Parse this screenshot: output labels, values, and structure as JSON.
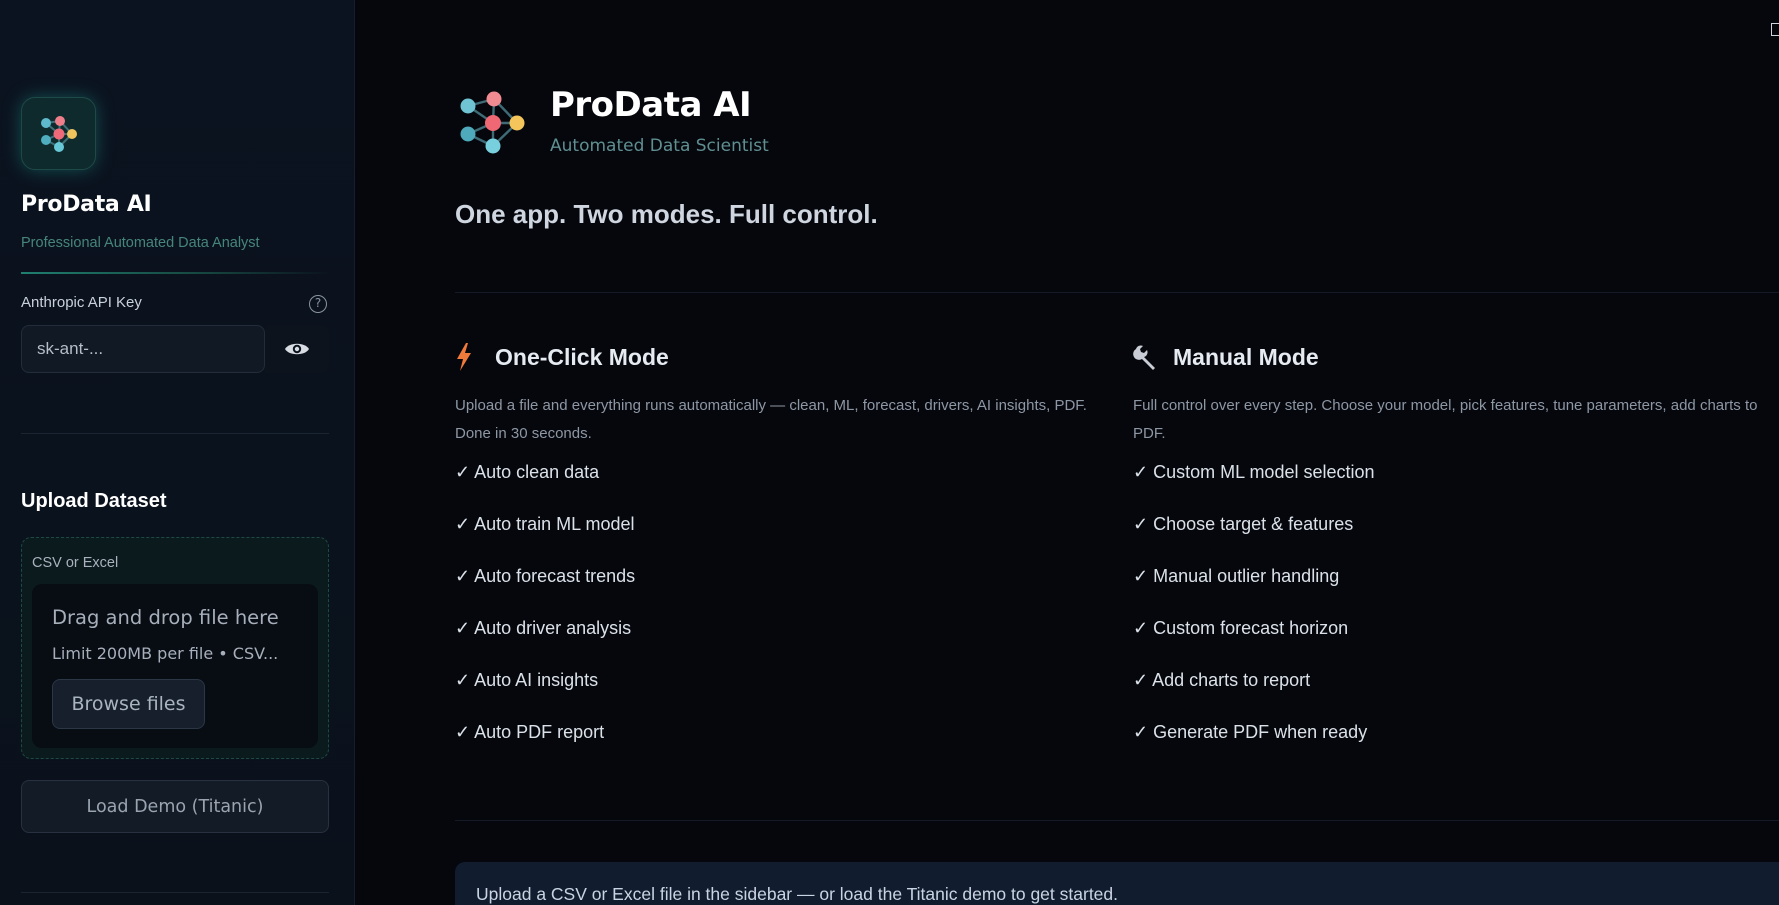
{
  "sidebar": {
    "logo_icon": "network-graph-icon",
    "title": "ProData AI",
    "subtitle": "Professional Automated Data Analyst",
    "api_key": {
      "label": "Anthropic API Key",
      "value": "",
      "placeholder": "sk-ant-...",
      "help_icon": "?",
      "toggle_icon": "eye-icon"
    },
    "upload": {
      "title": "Upload Dataset",
      "caption": "CSV or Excel",
      "drop_text": "Drag and drop file here",
      "limit_text": "Limit 200MB per file • CSV...",
      "browse_label": "Browse files"
    },
    "demo_button": "Load Demo (Titanic)"
  },
  "main": {
    "app_title": "ProData AI",
    "app_subtitle": "Automated Data Scientist",
    "tagline": "One app. Two modes. Full control.",
    "modes": [
      {
        "icon": "lightning-icon",
        "title": "One-Click Mode",
        "description": "Upload a file and everything runs automatically — clean, ML, forecast, drivers, AI insights, PDF. Done in 30 seconds.",
        "features": [
          "✓ Auto clean data",
          "✓ Auto train ML model",
          "✓ Auto forecast trends",
          "✓ Auto driver analysis",
          "✓ Auto AI insights",
          "✓ Auto PDF report"
        ]
      },
      {
        "icon": "wrench-icon",
        "title": "Manual Mode",
        "description": "Full control over every step. Choose your model, pick features, tune parameters, add charts to PDF.",
        "features": [
          "✓ Custom ML model selection",
          "✓ Choose target & features",
          "✓ Manual outlier handling",
          "✓ Custom forecast horizon",
          "✓ Add charts to report",
          "✓ Generate PDF when ready"
        ]
      }
    ],
    "notice": "Upload a CSV or Excel file in the sidebar — or load the Titanic demo to get started."
  },
  "colors": {
    "background": "#05070d",
    "sidebar": "#0b1320",
    "accent_teal": "#26beaa",
    "lightning": "#f07a3a",
    "notice_bg": "#111c2e"
  }
}
